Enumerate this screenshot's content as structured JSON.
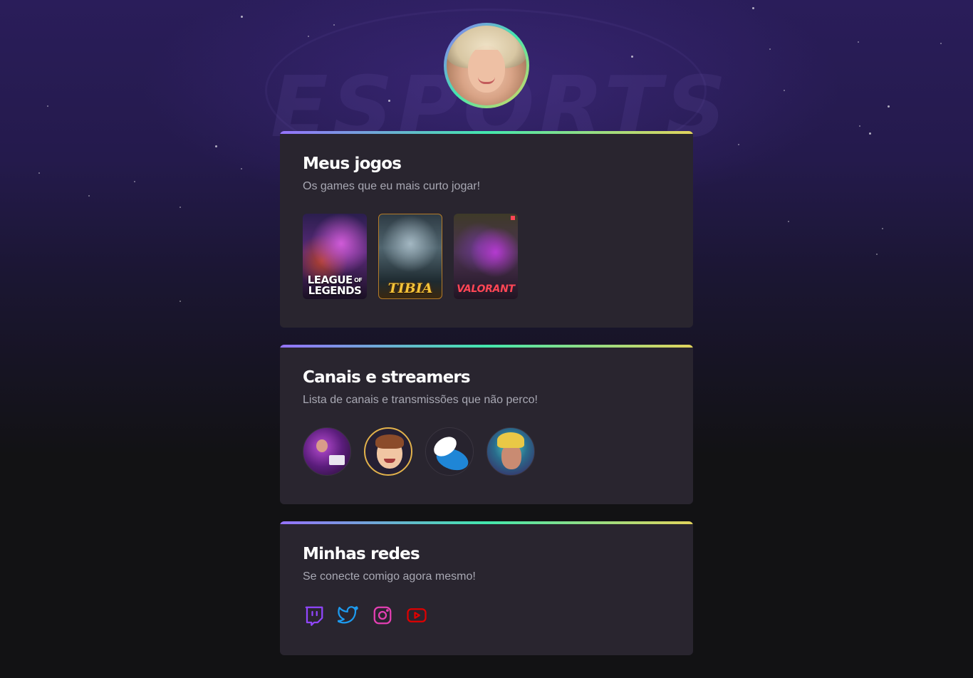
{
  "background": {
    "watermark_text": "ESPORTS"
  },
  "profile": {
    "avatar_icon": "user-avatar-photo"
  },
  "games_card": {
    "title": "Meus jogos",
    "subtitle": "Os games que eu mais curto jogar!",
    "games": [
      {
        "name": "LEAGUE OF LEGENDS",
        "line1": "LEAGUE",
        "line2": "LEGENDS"
      },
      {
        "name": "TIBIA"
      },
      {
        "name": "VALORANT"
      }
    ]
  },
  "channels_card": {
    "title": "Canais e streamers",
    "subtitle": "Lista de canais e transmissões que não perco!"
  },
  "social_card": {
    "title": "Minhas redes",
    "subtitle": "Se conecte comigo agora mesmo!",
    "networks": [
      {
        "icon": "twitch-icon",
        "color": "#9146ff"
      },
      {
        "icon": "twitter-icon",
        "color": "#1d9bf0"
      },
      {
        "icon": "instagram-icon",
        "color": "#e1306c"
      },
      {
        "icon": "youtube-icon",
        "color": "#e00000"
      }
    ]
  },
  "colors": {
    "gradient_start": "#9572fc",
    "gradient_mid": "#43e7ad",
    "gradient_end": "#e2d45c",
    "card_bg": "#29252f",
    "page_bg": "#121214"
  }
}
